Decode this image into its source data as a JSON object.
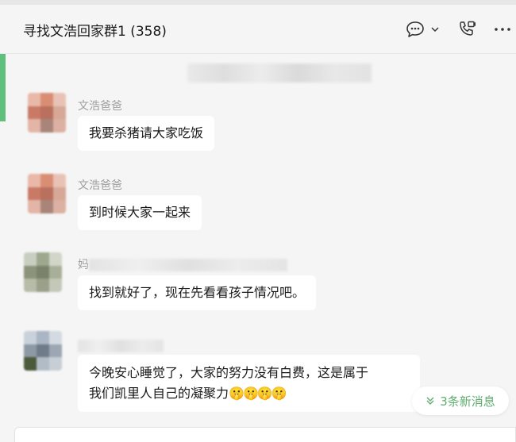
{
  "header": {
    "title": "寻找文浩回家群1 (358)"
  },
  "icons": {
    "chat": "chat-bubble-icon",
    "dropdown": "chevron-down-icon",
    "call": "phone-call-icon",
    "more": "more-dots-icon"
  },
  "messages": [
    {
      "sender": "文浩爸爸",
      "text": "我要杀猪请大家吃饭"
    },
    {
      "sender": "文浩爸爸",
      "text": "到时候大家一起来"
    },
    {
      "sender": "妈",
      "text": "找到就好了，现在先看看孩子情况吧。"
    },
    {
      "sender": "",
      "text_line1": "今晚安心睡觉了，大家的努力没有白费，这是属于",
      "text_line2": "我们凯里人自己的凝聚力",
      "emojis": "🤫🤫🤫🤫"
    }
  ],
  "new_messages": {
    "label": "3条新消息"
  },
  "colors": {
    "accent": "#5fae6e",
    "background": "#f5f5f5",
    "bubble": "#ffffff"
  }
}
